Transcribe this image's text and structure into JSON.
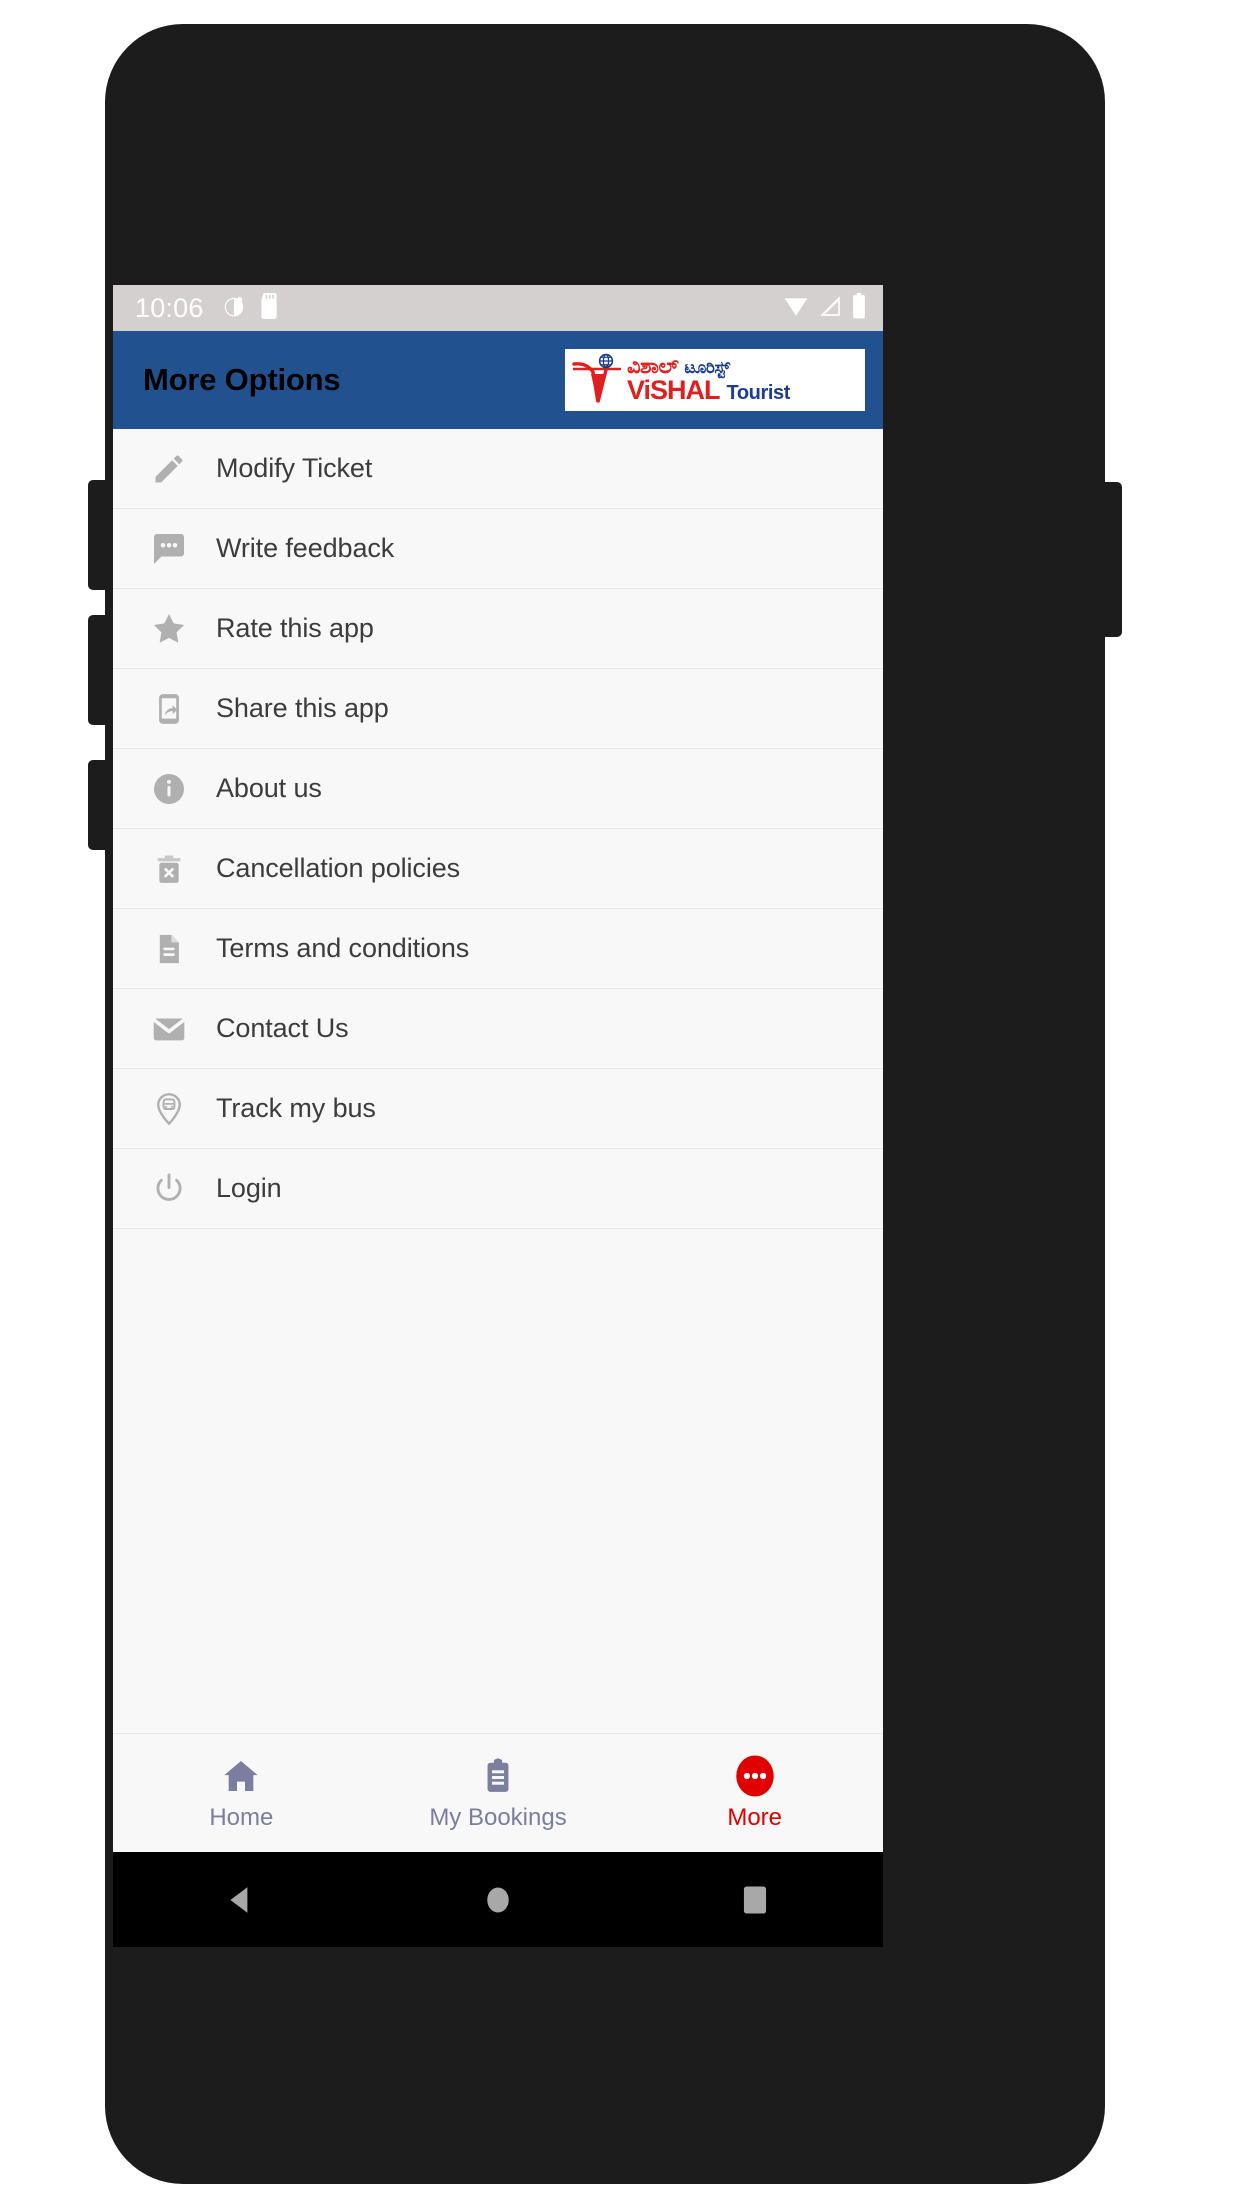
{
  "status_bar": {
    "time": "10:06",
    "left_icons": [
      "alarm-icon",
      "sd-card-icon"
    ],
    "right_icons": [
      "wifi-icon",
      "signal-icon",
      "battery-icon"
    ],
    "background": "#d4d0cf",
    "icon_color": "#ffffff"
  },
  "app_bar": {
    "title": "More Options",
    "background": "#22518f",
    "title_color": "#000000",
    "logo": {
      "kannada_main": "ವಿಶಾಲ್",
      "kannada_sub": "ಟೂರಿಸ್ಟ್",
      "english_main": "ViSHAL",
      "english_sub": "Tourist",
      "mark": "v-globe-logo-mark",
      "red": "#e01f1f",
      "blue": "#1b3c8f",
      "background": "#ffffff"
    }
  },
  "options": [
    {
      "label": "Modify Ticket",
      "icon": "pencil-icon"
    },
    {
      "label": "Write feedback",
      "icon": "chat-bubble-icon"
    },
    {
      "label": "Rate this app",
      "icon": "star-icon"
    },
    {
      "label": "Share this app",
      "icon": "phone-share-icon"
    },
    {
      "label": "About us",
      "icon": "info-circle-icon"
    },
    {
      "label": "Cancellation policies",
      "icon": "trash-x-icon"
    },
    {
      "label": "Terms and conditions",
      "icon": "document-icon"
    },
    {
      "label": "Contact Us",
      "icon": "envelope-icon"
    },
    {
      "label": "Track my bus",
      "icon": "map-pin-bus-icon"
    },
    {
      "label": "Login",
      "icon": "power-icon"
    }
  ],
  "list_style": {
    "background": "#f8f8f8",
    "icon_color": "#b0b0b0",
    "label_color": "#3c3c3c",
    "divider_color": "#e6e6e6"
  },
  "bottom_nav": {
    "items": [
      {
        "label": "Home",
        "icon": "home-icon",
        "active": false
      },
      {
        "label": "My Bookings",
        "icon": "clipboard-icon",
        "active": false
      },
      {
        "label": "More",
        "icon": "more-dots-icon",
        "active": true
      }
    ],
    "inactive_color": "#7b7e9e",
    "active_color": "#e00000",
    "background": "#f8f8f8"
  },
  "android_nav": {
    "buttons": [
      "back-triangle-icon",
      "home-circle-icon",
      "recents-square-icon"
    ],
    "background": "#000000",
    "icon_color": "#a8a8a8"
  },
  "device": {
    "frame_color": "#1c1c1c",
    "buttons": [
      "volume-up-button",
      "volume-down-button",
      "mute-button",
      "power-button"
    ]
  }
}
